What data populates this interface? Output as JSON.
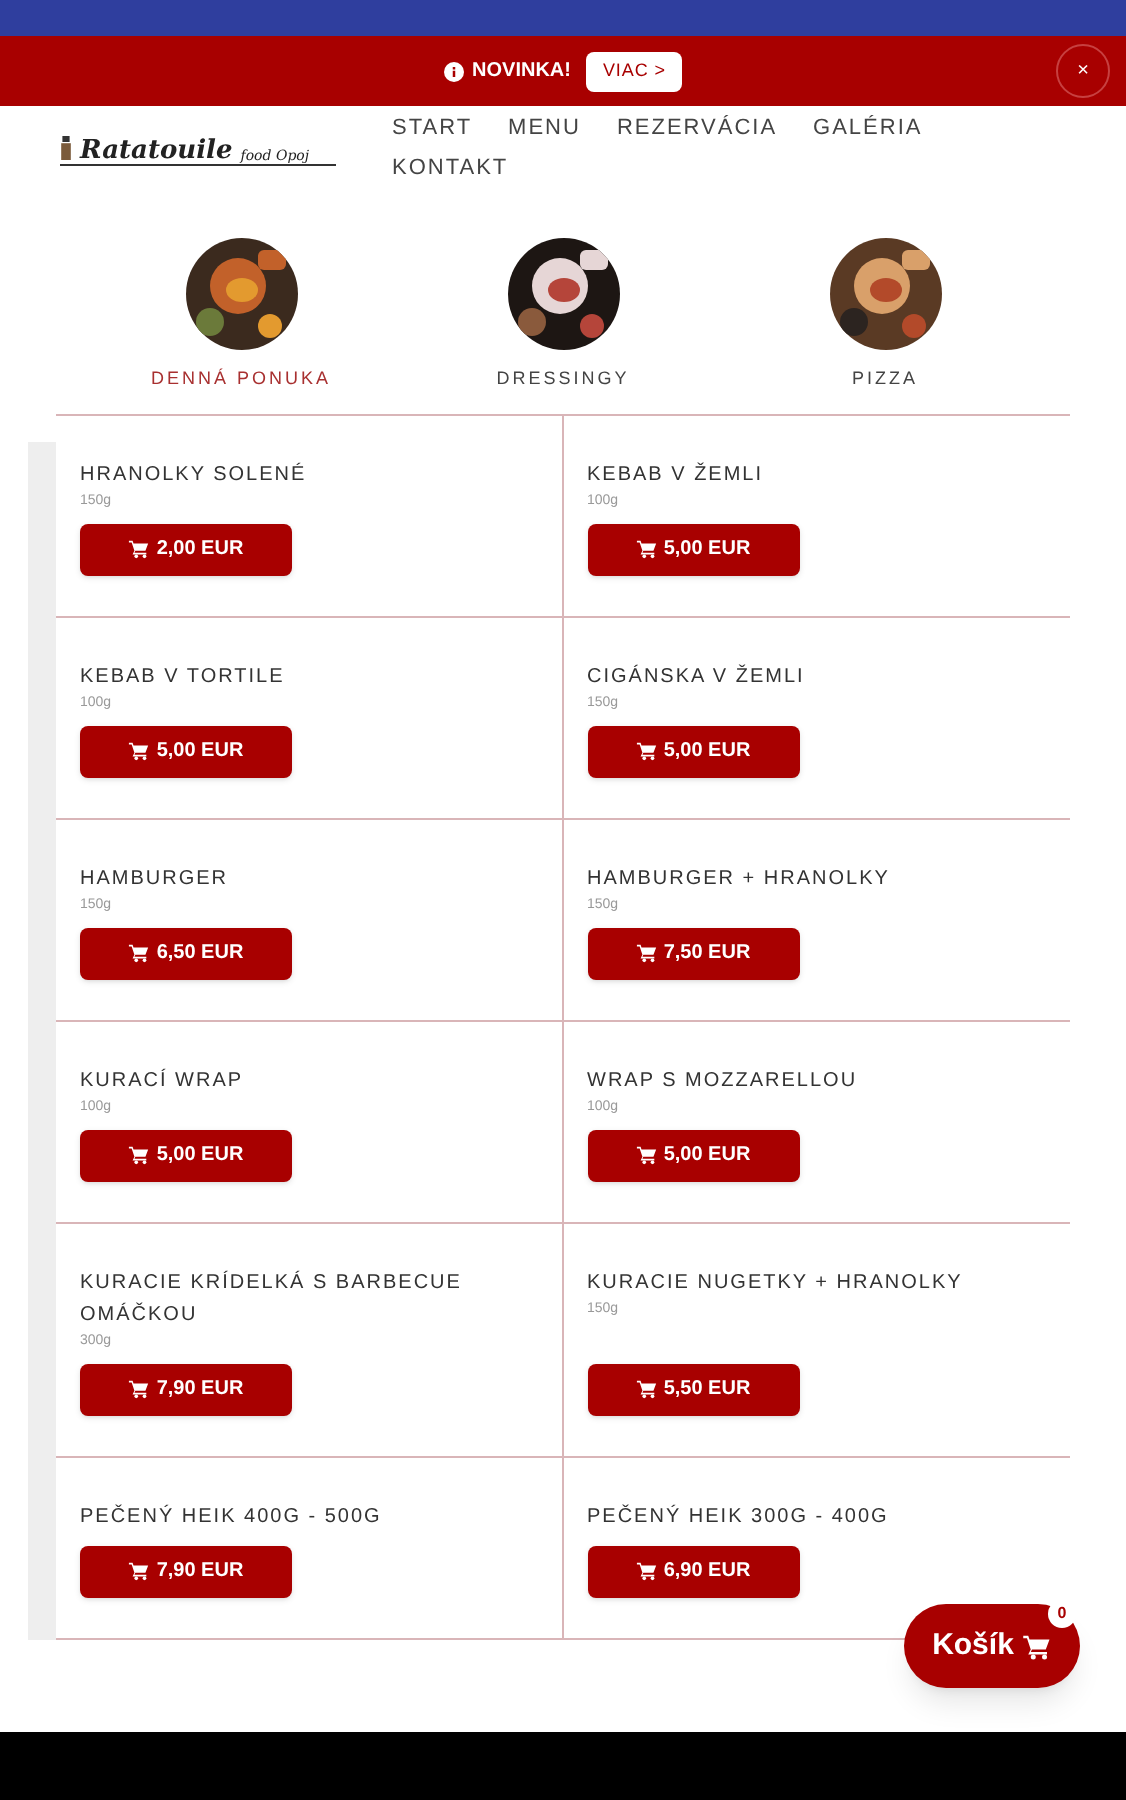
{
  "banner": {
    "label": "NOVINKA!",
    "button": "VIAC >",
    "close": "×"
  },
  "header": {
    "logo_title": "Ratatouile",
    "logo_subtitle": "food Opoj",
    "nav": [
      {
        "label": "START"
      },
      {
        "label": "MENU"
      },
      {
        "label": "REZERVÁCIA"
      },
      {
        "label": "GALÉRIA"
      },
      {
        "label": "KONTAKT"
      }
    ]
  },
  "categories": [
    {
      "label": "DENNÁ PONUKA",
      "selected": true,
      "kind": "picture"
    },
    {
      "label": "DRESSINGY",
      "selected": false,
      "kind": "picture"
    },
    {
      "label": "PIZZA",
      "selected": false,
      "kind": "picture"
    }
  ],
  "products": [
    {
      "name": "HRANOLKY SOLENÉ",
      "weight": "150g",
      "price": "2,00 EUR"
    },
    {
      "name": "KEBAB V ŽEMLI",
      "weight": "100g",
      "price": "5,00 EUR"
    },
    {
      "name": "KEBAB V TORTILE",
      "weight": "100g",
      "price": "5,00 EUR"
    },
    {
      "name": "CIGÁNSKA V ŽEMLI",
      "weight": "150g",
      "price": "5,00 EUR"
    },
    {
      "name": "HAMBURGER",
      "weight": "150g",
      "price": "6,50 EUR"
    },
    {
      "name": "HAMBURGER + HRANOLKY",
      "weight": "150g",
      "price": "7,50 EUR"
    },
    {
      "name": "KURACÍ WRAP",
      "weight": "100g",
      "price": "5,00 EUR"
    },
    {
      "name": "WRAP S MOZZARELLOU",
      "weight": "100g",
      "price": "5,00 EUR"
    },
    {
      "name": "KURACIE KRÍDELKÁ S BARBECUE OMÁČKOU",
      "weight": "300g",
      "price": "7,90 EUR"
    },
    {
      "name": "KURACIE NUGETKY + HRANOLKY",
      "weight": "150g",
      "price": "5,50 EUR"
    },
    {
      "name": "PEČENÝ HEIK 400G - 500G",
      "price": "7,90 EUR"
    },
    {
      "name": "PEČENÝ HEIK 300G - 400G",
      "price": "6,90 EUR"
    }
  ],
  "cart": {
    "label": "Košík",
    "count": "0"
  }
}
